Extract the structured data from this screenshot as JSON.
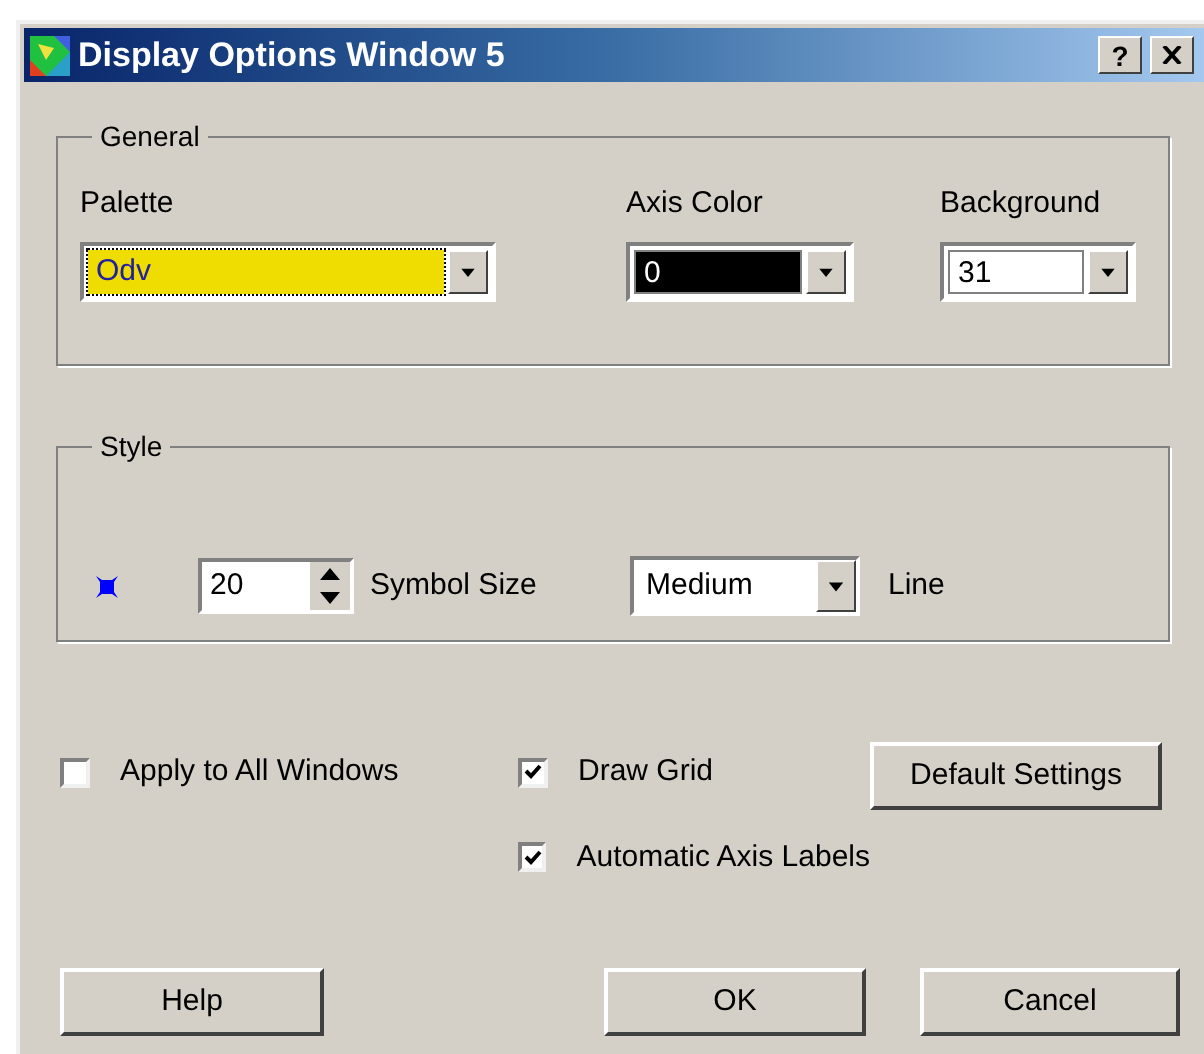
{
  "window": {
    "title": "Display Options Window 5",
    "help_button": "?"
  },
  "general": {
    "title": "General",
    "fields": [
      {
        "label": "Palette",
        "value": "Odv",
        "color": "#efdc00",
        "focused": true
      },
      {
        "label": "Axis Color",
        "value": "0",
        "color": "#000000",
        "focused": false
      },
      {
        "label": "Background",
        "value": "31",
        "color": "#ffffff",
        "focused": false
      }
    ]
  },
  "style": {
    "title": "Style",
    "symbol_size": {
      "value": "20",
      "label": "Symbol Size"
    },
    "line": {
      "value": "Medium",
      "label": "Line"
    }
  },
  "options": [
    {
      "label": "Apply to All Windows",
      "checked": false
    },
    {
      "label": "Draw Grid",
      "checked": true
    },
    {
      "label": "Automatic Axis Labels",
      "checked": true
    }
  ],
  "default_button": "Default Settings",
  "buttons": [
    "Help",
    "OK",
    "Cancel"
  ]
}
